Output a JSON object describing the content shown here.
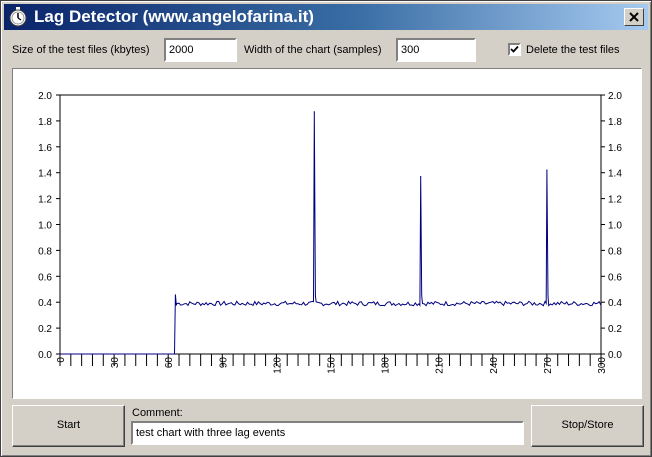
{
  "window": {
    "title": "Lag Detector (www.angelofarina.it)"
  },
  "settings": {
    "file_size_label": "Size of the test files (kbytes)",
    "file_size_value": "2000",
    "chart_width_label": "Width of the chart (samples)",
    "chart_width_value": "300",
    "delete_files_label": "Delete the test files",
    "delete_files_checked": true
  },
  "chart_data": {
    "type": "line",
    "xlim": [
      0,
      300
    ],
    "ylim": [
      0,
      2.0
    ],
    "x_ticks": [
      "0",
      "30",
      "60",
      "90",
      "120",
      "150",
      "180",
      "210",
      "240",
      "270",
      "300"
    ],
    "y_ticks": [
      "0.0",
      "0.2",
      "0.4",
      "0.6",
      "0.8",
      "1.0",
      "1.2",
      "1.4",
      "1.6",
      "1.8",
      "2.0"
    ],
    "series_color": "#000080",
    "start_sample": 64,
    "baseline": 0.39,
    "spikes": [
      {
        "x": 141,
        "y": 1.87
      },
      {
        "x": 200,
        "y": 1.37
      },
      {
        "x": 270,
        "y": 1.42
      }
    ]
  },
  "footer": {
    "start_label": "Start",
    "comment_label": "Comment:",
    "comment_value": "test chart with three lag events",
    "stop_label": "Stop/Store"
  }
}
